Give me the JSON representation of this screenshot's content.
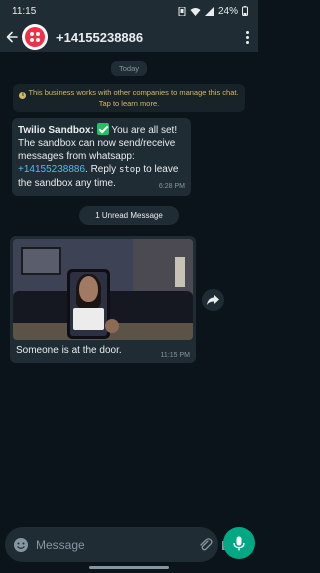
{
  "status_bar": {
    "time": "11:15",
    "battery": "24%"
  },
  "header": {
    "title": "+14155238886",
    "avatar_icon": "twilio-logo-icon",
    "brand_color": "#f22f46"
  },
  "chat": {
    "date_chip": "Today",
    "business_info": "This business works with other companies to manage this chat. Tap to learn more.",
    "message1": {
      "sender": "Twilio Sandbox",
      "colon": ":",
      "line1": " You are all set! The sandbox can now send/receive messages from whatsapp: ",
      "phone": "+14155238886",
      "line2": ". Reply ",
      "code": "stop",
      "line3": " to leave the sandbox any time.",
      "time": "6:28 PM"
    },
    "unread_label": "1 Unread Message",
    "message2": {
      "caption": "Someone is at the door.",
      "time": "11:15 PM"
    }
  },
  "composer": {
    "placeholder": "Message"
  },
  "colors": {
    "accent": "#00a884",
    "link": "#53bdeb",
    "bubble": "#1f2c34",
    "background": "#0b141a"
  }
}
